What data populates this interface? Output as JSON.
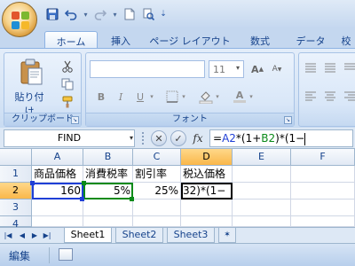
{
  "quick_access": {
    "save_icon": "save-icon",
    "undo_icon": "undo-icon",
    "redo_icon": "redo-icon",
    "new_icon": "new-document-icon",
    "print_preview_icon": "print-preview-icon",
    "customize_icon": "customize-qat-icon"
  },
  "ribbon_tabs": [
    {
      "label": "ホーム",
      "active": true
    },
    {
      "label": "挿入"
    },
    {
      "label": "ページ レイアウト"
    },
    {
      "label": "数式"
    },
    {
      "label": "データ"
    },
    {
      "label": "校"
    }
  ],
  "ribbon": {
    "clipboard": {
      "paste_label": "貼り付け",
      "group_label": "クリップボード"
    },
    "font": {
      "font_name": "",
      "font_size": "11",
      "bold": "B",
      "italic": "I",
      "underline": "U",
      "grow": "A",
      "shrink": "A",
      "font_color": "A",
      "group_label": "フォント"
    }
  },
  "formula_bar": {
    "name_box": "FIND",
    "cancel_glyph": "✕",
    "enter_glyph": "✓",
    "fx_label": "fx",
    "formula_prefix": "=",
    "formula_ref1": "A2",
    "formula_mid": "*(1+",
    "formula_ref2": "B2",
    "formula_suffix": ")*(1−"
  },
  "grid": {
    "columns": [
      "A",
      "B",
      "C",
      "D",
      "E",
      "F"
    ],
    "rows": [
      "1",
      "2",
      "3",
      "4"
    ],
    "cells": {
      "A1": "商品価格",
      "B1": "消費税率",
      "C1": "割引率",
      "D1": "税込価格",
      "A2": "160",
      "B2": "5%",
      "C2": "25%",
      "D2": "32)*(1−"
    }
  },
  "sheets": [
    {
      "label": "Sheet1",
      "active": true
    },
    {
      "label": "Sheet2"
    },
    {
      "label": "Sheet3"
    }
  ],
  "status": {
    "mode": "編集"
  },
  "colors": {
    "ref_a2": "#1f3fd6",
    "ref_b2": "#0a8a19",
    "ribbon": "#d7e5f6",
    "header_selected": "#f9b74a"
  }
}
